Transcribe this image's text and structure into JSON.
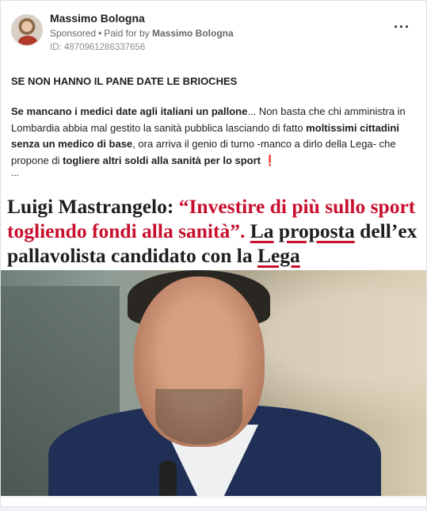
{
  "post": {
    "author": "Massimo Bologna",
    "sponsored": "Sponsored",
    "paid_for_prefix": "Paid for by",
    "paid_for_name": "Massimo Bologna",
    "ad_id": "ID: 4870961286337656",
    "more_icon": "more-options-icon",
    "headline_text": "SE NON HANNO IL PANE DATE LE BRIOCHES",
    "body": {
      "s1": "Se mancano i medici date agli italiani un pallone",
      "s2": "... Non basta che chi amministra in Lombardia abbia mal gestito la sanità pubblica lasciando di fatto ",
      "s3": "moltissimi cittadini senza un medico di base",
      "s4": ", ora arriva il genio di turno -manco a dirlo della Lega- che propone di ",
      "s5": "togliere altri soldi alla sanità per lo sport",
      "s6": " ❗",
      "ellipsis": "..."
    }
  },
  "image": {
    "headline_black1": "Luigi Mastrangelo: ",
    "headline_red": "“Investire di più sullo sport togliendo fondi alla sanità”.",
    "headline_black2_ul1": "La",
    "headline_black2_mid": " ",
    "headline_black2_ul2": "proposta",
    "headline_black2_rest": " dell’ex pallavolista candidato con la ",
    "headline_black2_ul3": "Lega",
    "accent_color": "#c8102e"
  }
}
